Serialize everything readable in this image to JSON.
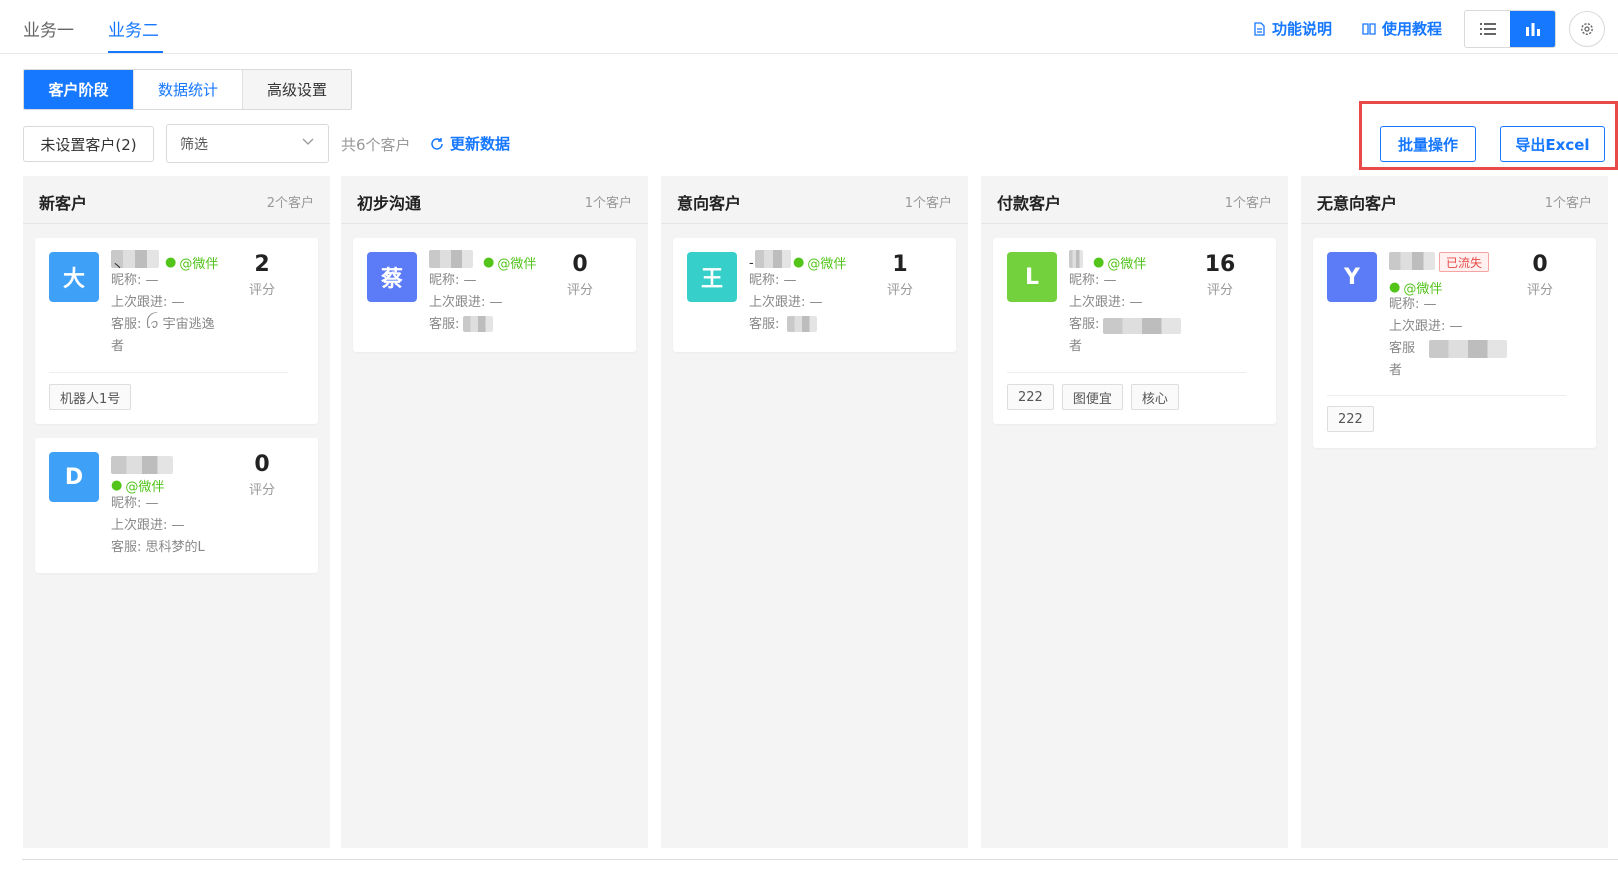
{
  "nav": {
    "tabs": [
      {
        "label": "业务一"
      },
      {
        "label": "业务二"
      }
    ],
    "links": {
      "feature_desc": "功能说明",
      "tutorial": "使用教程"
    }
  },
  "segment": {
    "tabs": [
      {
        "label": "客户阶段"
      },
      {
        "label": "数据统计"
      },
      {
        "label": "高级设置"
      }
    ]
  },
  "toolbar": {
    "unset_button": "未设置客户(2)",
    "filter_placeholder": "筛选",
    "total": "共6个客户",
    "refresh": "更新数据",
    "batch": "批量操作",
    "export": "导出Excel"
  },
  "columns": [
    {
      "title": "新客户",
      "count": "2个客户",
      "cards": [
        {
          "avatar": "大",
          "color": "#3ea0f7",
          "name_mark": "丶",
          "wx": "@微伴",
          "nick": "昵称: —",
          "last": "上次跟进: —",
          "service_line1": "客服: ꪶꪫ 宇宙逃逸",
          "service_line2": "者",
          "score": "2",
          "score_label": "评分",
          "tags": [
            "机器人1号"
          ]
        },
        {
          "avatar": "D",
          "color": "#3ea0f7",
          "wx": "@微伴",
          "nick": "昵称: —",
          "last": "上次跟进: —",
          "service": "客服: 思科梦的L",
          "score": "0",
          "score_label": "评分"
        }
      ]
    },
    {
      "title": "初步沟通",
      "count": "1个客户",
      "cards": [
        {
          "avatar": "蔡",
          "color": "#5b7cf6",
          "wx": "@微伴",
          "nick": "昵称: —",
          "last": "上次跟进: —",
          "service": "客服:",
          "score": "0",
          "score_label": "评分"
        }
      ]
    },
    {
      "title": "意向客户",
      "count": "1个客户",
      "cards": [
        {
          "avatar": "王",
          "color": "#36cfc9",
          "name_mark": "-",
          "wx": "@微伴",
          "nick": "昵称: —",
          "last": "上次跟进: —",
          "service": "客服:",
          "score": "1",
          "score_label": "评分"
        }
      ]
    },
    {
      "title": "付款客户",
      "count": "1个客户",
      "cards": [
        {
          "avatar": "L",
          "color": "#73d13d",
          "wx": "@微伴",
          "nick": "昵称: —",
          "last": "上次跟进: —",
          "service_line1": "客服:",
          "service_line2": "者",
          "score": "16",
          "score_label": "评分",
          "tags": [
            "222",
            "图便宜",
            "核心"
          ]
        }
      ]
    },
    {
      "title": "无意向客户",
      "count": "1个客户",
      "cards": [
        {
          "avatar": "Y",
          "color": "#5b7cf6",
          "badge": "已流失",
          "wx": "@微伴",
          "nick": "昵称: —",
          "last": "上次跟进: —",
          "service_line1": "客服",
          "service_line2": "者",
          "score": "0",
          "score_label": "评分",
          "tags": [
            "222"
          ]
        }
      ]
    }
  ]
}
